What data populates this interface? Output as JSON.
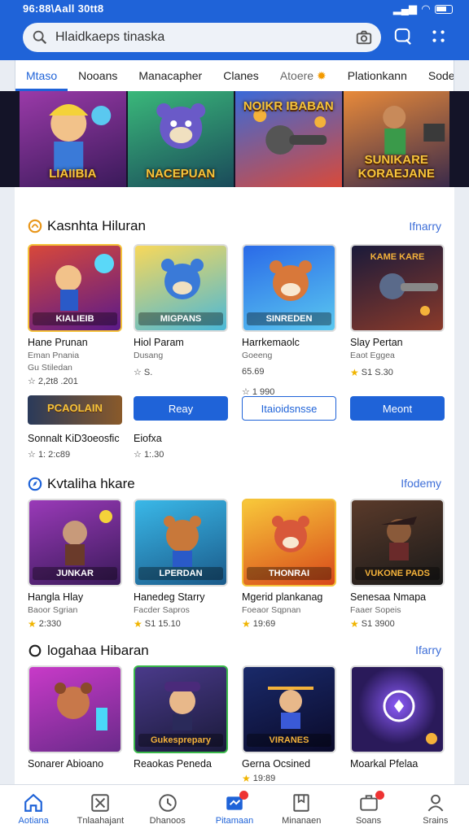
{
  "status_bar": {
    "time": "96:88\\Aall 30tt8"
  },
  "search": {
    "placeholder": "Hlaidkaeps tinaska",
    "icon": "search-icon"
  },
  "tabs": [
    {
      "label": "Mtaso"
    },
    {
      "label": "Nooans"
    },
    {
      "label": "Manacapher"
    },
    {
      "label": "Clanes"
    },
    {
      "label": "Atoere"
    },
    {
      "label": "Plationkann"
    },
    {
      "label": "Sodenp"
    }
  ],
  "banners": [
    {
      "label": "LIAIIBIA",
      "color": "#7a2a86"
    },
    {
      "label": "NACEPUAN",
      "color": "#2a7a4a"
    },
    {
      "label": "NOIKR IBABAN",
      "color": "#2a3a9a"
    },
    {
      "label": "SUNIKARE KORAEJANE",
      "color": "#7a4a1a"
    }
  ],
  "sections": [
    {
      "title": "Kasnhta Hiluran",
      "more": "Ifnarry",
      "cards": [
        {
          "thumb_label": "KIALIEIB",
          "name": "Hane Prunan",
          "sub1": "Eman Pnania",
          "sub2": "Gu Stiledan",
          "rating": "2,2t8  .201",
          "color": "#b5342a"
        },
        {
          "thumb_label": "MIGPANS",
          "name": "Hiol Param",
          "sub1": "Dusang",
          "sub2": "",
          "rating": "S.",
          "color": "#4a9ad8"
        },
        {
          "thumb_label": "SINREDEN",
          "name": "Harrkemaolc",
          "sub1": "Goeeng",
          "sub2": "",
          "rating": "65.69",
          "color": "#2a5ac8"
        },
        {
          "thumb_label": "KAME KARE",
          "name": "Slay Pertan",
          "sub1": "Eaot Eggea",
          "sub2": "",
          "rating": "S1 S.30",
          "color": "#2a2a4a"
        }
      ],
      "extra_rating_3": "1 990",
      "buttons": [
        {
          "label": "Reay",
          "style": "fill"
        },
        {
          "label": "Itaioidsnsse",
          "style": "out"
        },
        {
          "label": "Meont",
          "style": "fill"
        }
      ],
      "mini_card": {
        "label": "PCAOLAIN",
        "name": "Sonnalt KiD3oeosfic",
        "rating": "1: 2:c89",
        "color": "#2a3a5a"
      },
      "mini_card2": {
        "name": "Eiofxa",
        "rating": "1:.30"
      }
    },
    {
      "title": "Kvtaliha hkare",
      "more": "Ifodemy",
      "cards": [
        {
          "thumb_label": "JUNKAR",
          "name": "Hangla Hlay",
          "sub1": "Baoor Sgrian",
          "rating": "2:330",
          "color": "#8a2a9a"
        },
        {
          "thumb_label": "LPERDAN",
          "name": "Hanedeg Starry",
          "sub1": "Facder Sapros",
          "rating": "S1 15.10",
          "color": "#2a9ad8"
        },
        {
          "thumb_label": "THONRAI",
          "name": "Mgerid plankanag",
          "sub1": "Foeaor Sqpnan",
          "rating": "19:69",
          "color": "#d88a1a"
        },
        {
          "thumb_label": "VUKONE PADS",
          "name": "Senesaa Nmapa",
          "sub1": "Faaer Sopeis",
          "rating": "S1 3900",
          "color": "#4a2a2a"
        }
      ]
    },
    {
      "title": "logahaa Hibaran",
      "more": "Ifarry",
      "cards": [
        {
          "thumb_label": "",
          "name": "Sonarer Abioano",
          "rating": "",
          "color": "#a83aa8"
        },
        {
          "thumb_label": "Gukesprepary",
          "name": "Reaokas Peneda",
          "rating": "",
          "color": "#3a2a6a"
        },
        {
          "thumb_label": "VIRANES",
          "name": "Gerna Ocsined",
          "rating": "19:89",
          "color": "#1a2a5a"
        },
        {
          "thumb_label": "",
          "name": "Moarkal Pfelaa",
          "rating": "",
          "color": "#2a1a5a"
        }
      ]
    }
  ],
  "bottom_nav": [
    {
      "label": "Aotiana",
      "icon": "home-icon",
      "active": true
    },
    {
      "label": "Tnlaahajant",
      "icon": "tools-icon"
    },
    {
      "label": "Dhanoos",
      "icon": "clock-icon"
    },
    {
      "label": "Pitamaan",
      "icon": "flag-icon",
      "active": true,
      "badge": true
    },
    {
      "label": "Minanaen",
      "icon": "book-icon"
    },
    {
      "label": "Soans",
      "icon": "briefcase-icon",
      "badge": true
    },
    {
      "label": "Srains",
      "icon": "profile-icon"
    }
  ],
  "colors": {
    "accent": "#1f63d8",
    "star": "#f0b400"
  }
}
